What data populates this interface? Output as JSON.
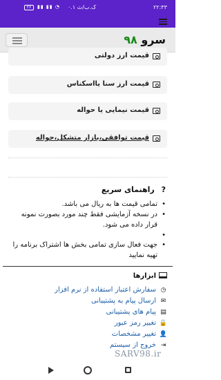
{
  "status_bar": {
    "time": "۲۲:۳۳",
    "network": "۰.۱ ک.ب/ث",
    "battery": "۲۶"
  },
  "brand": {
    "name": "سرو",
    "number": "۹۸"
  },
  "rates": [
    {
      "label": "قیمت ارز دولتی",
      "icon": "money-bill-icon",
      "link": false
    },
    {
      "label": "قیمت ارز سنا یااسکناس",
      "icon": "money-bill-icon",
      "link": false
    },
    {
      "label": "قیمت نیمایی یا حواله",
      "icon": "money-bill-icon",
      "link": false
    },
    {
      "label": "قیمت توافقی،بازار متشکل،حواله",
      "icon": "money-bill-icon",
      "link": true
    }
  ],
  "guide": {
    "title": "راهنمای سریع",
    "icon": "question-icon",
    "items": [
      "تمامی قیمت ها به ریال می باشد.",
      "در نسخه آزمایشی فقط چند مورد بصورت نمونه قرار داده می شود.",
      "",
      "جهت فعال سازی تمامی بخش ها اشتراک برنامه را تهیه نمایید"
    ]
  },
  "tools": {
    "title": "ابزارها",
    "items": [
      {
        "label": "سفارش اعتبار استفاده از نرم افزار",
        "icon": "clock-icon",
        "glyph": "◷"
      },
      {
        "label": "ارسال پیام به پشتیبانی",
        "icon": "envelope-icon",
        "glyph": "✉"
      },
      {
        "label": "پیام های پشتیبانی",
        "icon": "chat-icon",
        "glyph": "▤"
      },
      {
        "label": "تغییر رمز عبور",
        "icon": "lock-icon",
        "glyph": "🔒"
      },
      {
        "label": "تغییر مشخصات",
        "icon": "user-icon",
        "glyph": "👤"
      },
      {
        "label": "خروج از سیستم",
        "icon": "logout-icon",
        "glyph": "⇥"
      }
    ]
  },
  "watermark": "SARV98.ir"
}
